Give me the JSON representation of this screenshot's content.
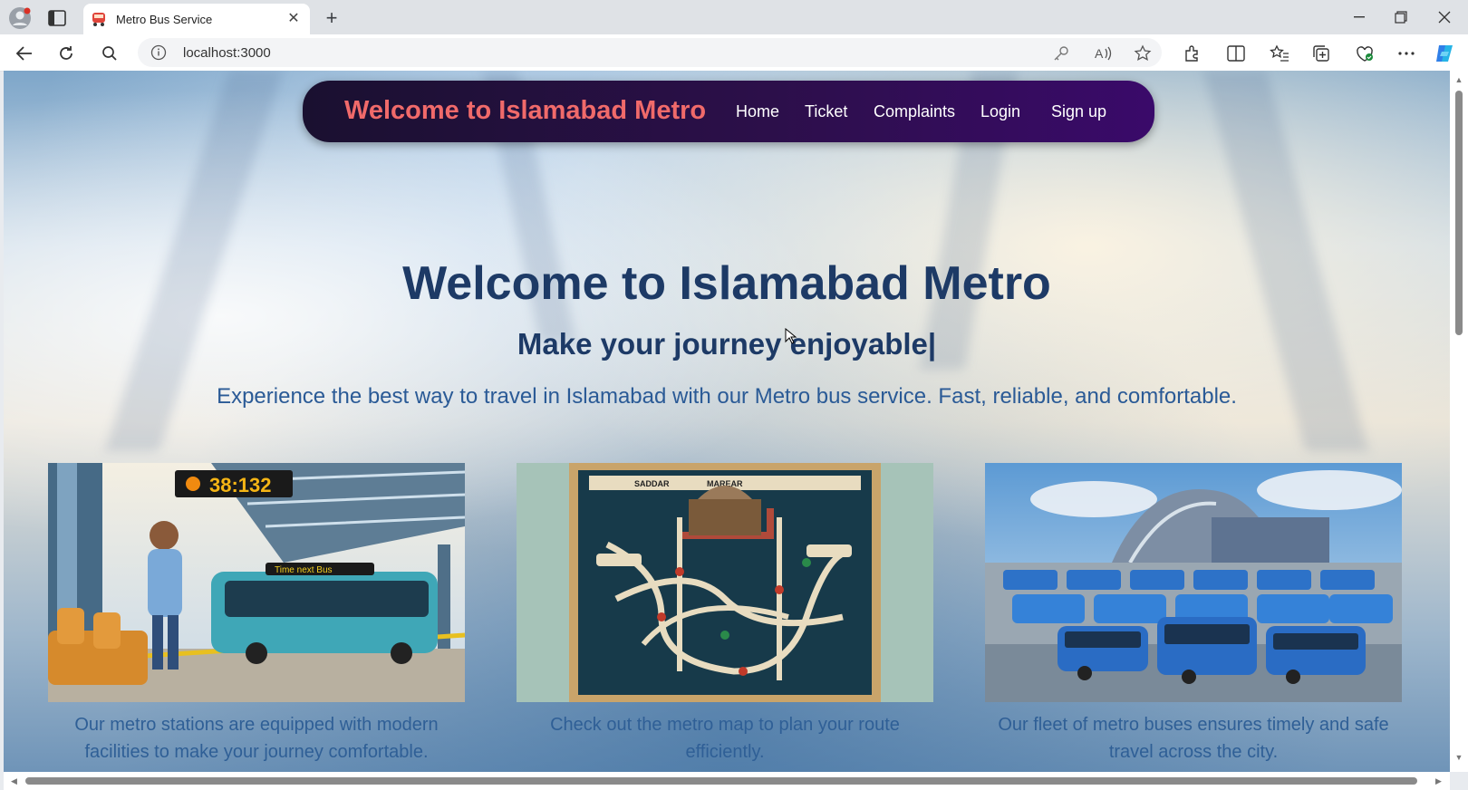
{
  "browser": {
    "tab_title": "Metro Bus Service",
    "url": "localhost:3000"
  },
  "site": {
    "nav": {
      "brand": "Welcome to Islamabad Metro",
      "links": [
        "Home",
        "Ticket",
        "Complaints",
        "Login",
        "Sign up"
      ]
    },
    "hero": {
      "title": "Welcome to Islamabad Metro",
      "subtitle": "Make your journey enjoyable|",
      "description": "Experience the best way to travel in Islamabad with our Metro bus service. Fast, reliable, and comfortable."
    },
    "cards": [
      {
        "caption": "Our metro stations are equipped with modern facilities to make your journey comfortable.",
        "timer_text": "38:132",
        "bus_sign": "Time next Bus"
      },
      {
        "caption": "Check out the metro map to plan your route efficiently.",
        "map_labels": [
          "SADDAR",
          "MAREAR"
        ]
      },
      {
        "caption": "Our fleet of metro buses ensures timely and safe travel across the city."
      }
    ]
  },
  "colors": {
    "navbar_bg": "#2c0f4a",
    "brand": "#f06a6a",
    "hero_title": "#1d3a66",
    "hero_desc": "#2a5a96",
    "caption": "#2f5f96"
  },
  "icons": [
    "profile-icon",
    "workspaces-icon",
    "metro-favicon",
    "close-tab-icon",
    "new-tab-icon",
    "minimize-icon",
    "maximize-icon",
    "close-window-icon",
    "back-icon",
    "reload-icon",
    "search-icon",
    "info-icon",
    "password-key-icon",
    "read-aloud-icon",
    "favorite-star-icon",
    "extensions-icon",
    "split-screen-icon",
    "favorites-icon",
    "collections-icon",
    "browser-essentials-icon",
    "more-icon",
    "copilot-icon"
  ]
}
